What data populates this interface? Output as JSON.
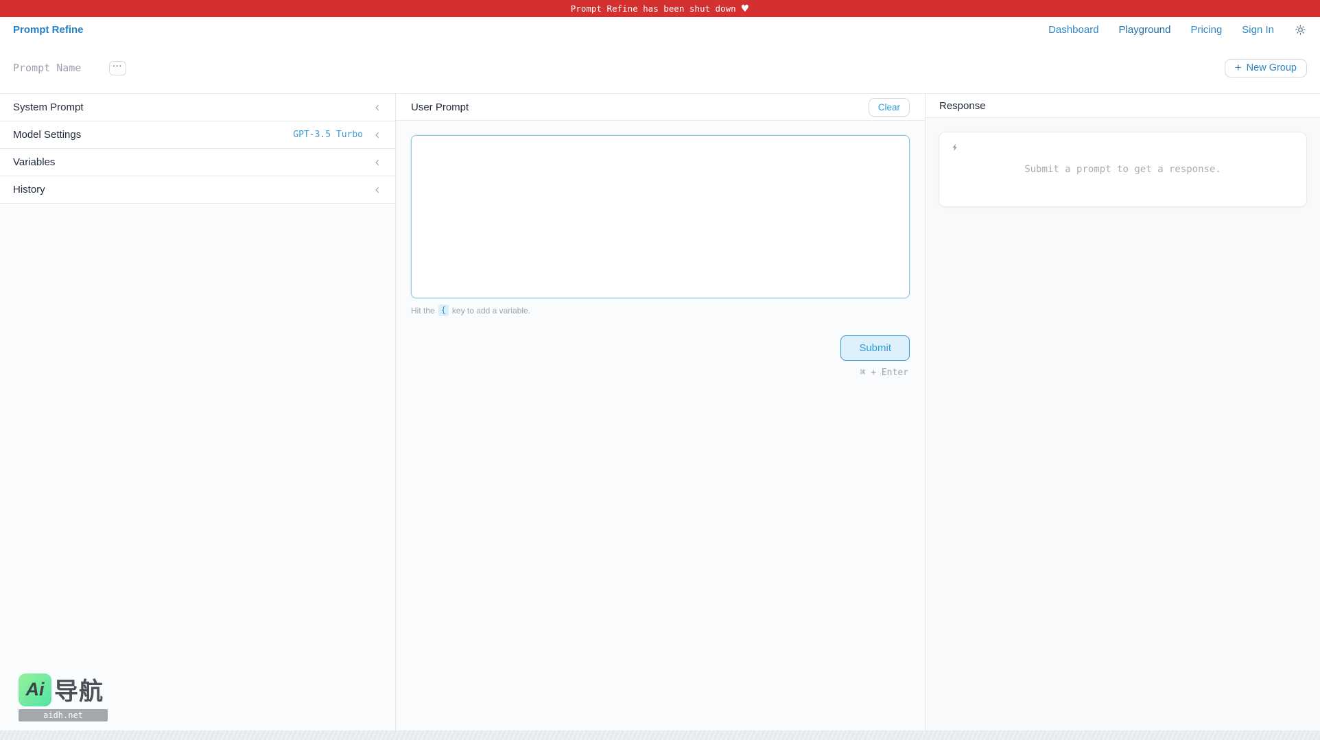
{
  "banner": {
    "text": "Prompt Refine has been shut down",
    "heart": "♥"
  },
  "header": {
    "logo": "Prompt Refine",
    "nav": {
      "dashboard": "Dashboard",
      "playground": "Playground",
      "pricing": "Pricing",
      "signin": "Sign In"
    }
  },
  "toolbar": {
    "prompt_name_placeholder": "Prompt Name",
    "more_label": "···",
    "new_group_plus": "+",
    "new_group_label": "New Group"
  },
  "sidebar": {
    "items": [
      {
        "label": "System Prompt",
        "value": ""
      },
      {
        "label": "Model Settings",
        "value": "GPT-3.5 Turbo"
      },
      {
        "label": "Variables",
        "value": ""
      },
      {
        "label": "History",
        "value": ""
      }
    ]
  },
  "user_prompt": {
    "title": "User Prompt",
    "clear_label": "Clear",
    "textarea_value": "",
    "hint_prefix": "Hit the",
    "hint_key": "{",
    "hint_suffix": "key to add a variable.",
    "submit_label": "Submit",
    "shortcut": "⌘ + Enter"
  },
  "response": {
    "title": "Response",
    "placeholder": "Submit a prompt to get a response."
  },
  "watermark": {
    "badge": "Ai",
    "title": "导航",
    "domain": "aidh.net"
  },
  "colors": {
    "banner_red": "#d3302f",
    "accent_blue": "#2d9cdb",
    "link_blue": "#2e86c4",
    "logo_blue": "#2581c4",
    "muted_gray": "#9ca3af",
    "divider": "#e5e7eb"
  }
}
